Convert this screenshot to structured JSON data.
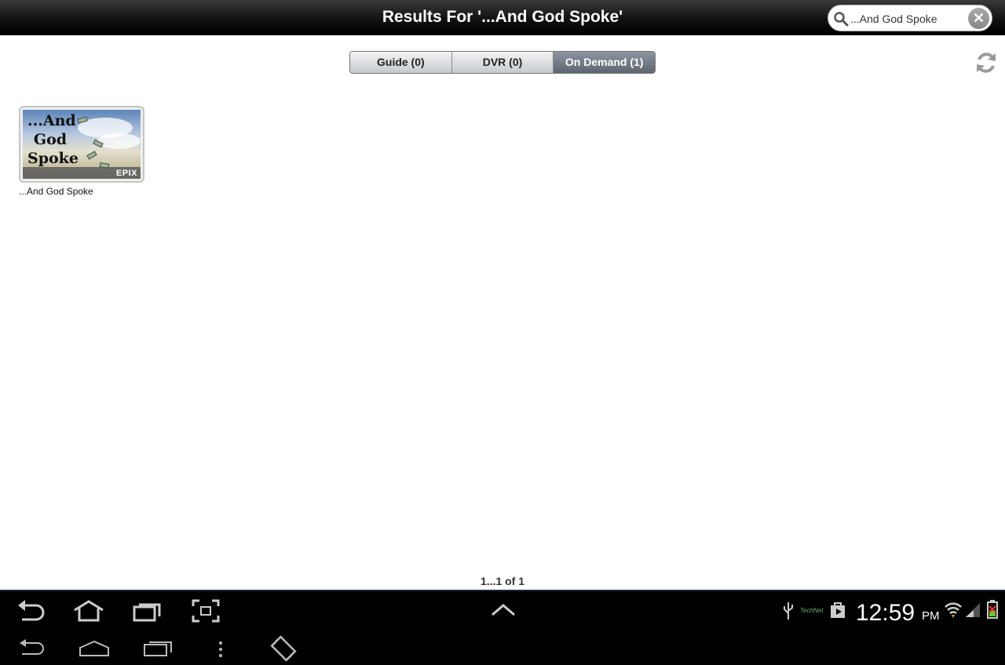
{
  "header": {
    "title": "Results For '...And God Spoke'",
    "search_value": "...And God Spoke"
  },
  "tabs": [
    {
      "label": "Guide (0)",
      "active": false
    },
    {
      "label": "DVR (0)",
      "active": false
    },
    {
      "label": "On Demand (1)",
      "active": true
    }
  ],
  "results": [
    {
      "title": "...And God Spoke",
      "thumb_text": "...And God Spoke",
      "network": "EPIX"
    }
  ],
  "pagination": {
    "text": "1...1 of 1"
  },
  "system_bar": {
    "time": "12:59",
    "ampm": "PM",
    "status_logo": "TechNet"
  },
  "colors": {
    "active_tab": "#6b7380",
    "title_bar": "#000000",
    "system_bar": "#000000"
  }
}
